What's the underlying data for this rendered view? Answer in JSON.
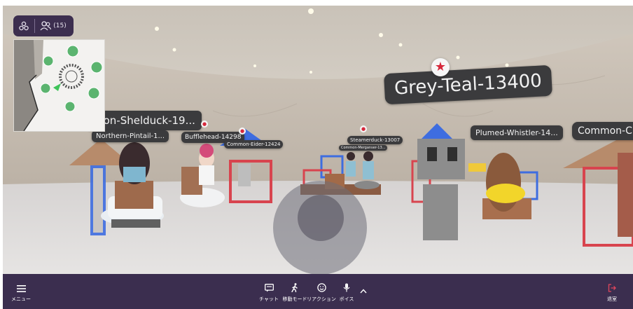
{
  "top_controls": {
    "users_count": "(15)",
    "layers_icon": "layers-icon",
    "users_icon": "users-icon"
  },
  "avatars": {
    "featured_name": "Grey-Teal-13400",
    "names": [
      "mon-Shelduck-19...",
      "Northern-Pintail-1...",
      "Bufflehead-14298",
      "Common-Eider-12424",
      "Steamerduck-13007",
      "Common-Merganser-13...",
      "Plumed-Whistler-14...",
      "Common-C"
    ]
  },
  "bottom_bar": {
    "menu": {
      "label": "メニュー",
      "icon": "hamburger-icon"
    },
    "chat": {
      "label": "チャット",
      "icon": "chat-icon"
    },
    "move_mode": {
      "label": "移動モード",
      "icon": "walk-icon"
    },
    "reaction": {
      "label": "リアクション",
      "icon": "smiley-icon"
    },
    "voice": {
      "label": "ボイス",
      "icon": "microphone-icon",
      "expand_icon": "chevron-up-icon"
    },
    "exit": {
      "label": "退室",
      "icon": "exit-icon"
    }
  },
  "colors": {
    "bar_bg": "#3b2e4f",
    "exit_accent": "#e0465c",
    "marker_red": "#d6283b"
  }
}
